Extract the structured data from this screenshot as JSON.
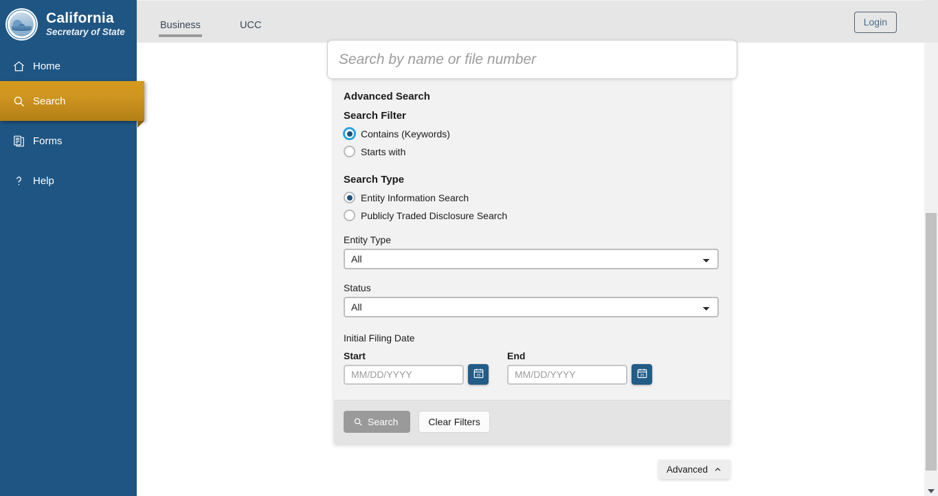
{
  "sidebar": {
    "brand": {
      "line1": "California",
      "line2": "Secretary of State",
      "seal_icon": "california-state-seal-icon"
    },
    "items": [
      {
        "label": "Home",
        "icon": "home-icon",
        "active": false
      },
      {
        "label": "Search",
        "icon": "search-icon",
        "active": true
      },
      {
        "label": "Forms",
        "icon": "forms-icon",
        "active": false
      },
      {
        "label": "Help",
        "icon": "help-icon",
        "active": false
      }
    ]
  },
  "topbar": {
    "tabs": [
      {
        "label": "Business",
        "active": true
      },
      {
        "label": "UCC",
        "active": false
      }
    ],
    "login_label": "Login"
  },
  "search": {
    "value": "",
    "placeholder": "Search by name or file number"
  },
  "panel": {
    "advanced_search_heading": "Advanced Search",
    "search_filter": {
      "heading": "Search Filter",
      "options": [
        {
          "label": "Contains (Keywords)",
          "selected": true,
          "focused": true
        },
        {
          "label": "Starts with",
          "selected": false,
          "focused": false
        }
      ]
    },
    "search_type": {
      "heading": "Search Type",
      "options": [
        {
          "label": "Entity Information Search",
          "selected": true,
          "focused": false
        },
        {
          "label": "Publicly Traded Disclosure Search",
          "selected": false,
          "focused": false
        }
      ]
    },
    "entity_type": {
      "label": "Entity Type",
      "value": "All",
      "options": [
        "All"
      ]
    },
    "status": {
      "label": "Status",
      "value": "All",
      "options": [
        "All"
      ]
    },
    "initial_filing_date": {
      "label": "Initial Filing Date",
      "start": {
        "label": "Start",
        "value": "",
        "placeholder": "MM/DD/YYYY",
        "calendar_icon": "calendar-icon"
      },
      "end": {
        "label": "End",
        "value": "",
        "placeholder": "MM/DD/YYYY",
        "calendar_icon": "calendar-icon"
      }
    },
    "footer": {
      "search_label": "Search",
      "clear_label": "Clear Filters"
    },
    "advanced_toggle": {
      "label": "Advanced",
      "icon": "chevron-up-icon"
    }
  },
  "colors": {
    "sidebar_blue": "#1f5582",
    "active_gold": "#cf9520",
    "radio_focus_cyan": "#27a3e2",
    "radio_fill_navy": "#1c5380",
    "calendar_btn_blue": "#225c87",
    "panel_bg": "#f2f2f2",
    "topbar_bg": "#e6e6e6"
  }
}
